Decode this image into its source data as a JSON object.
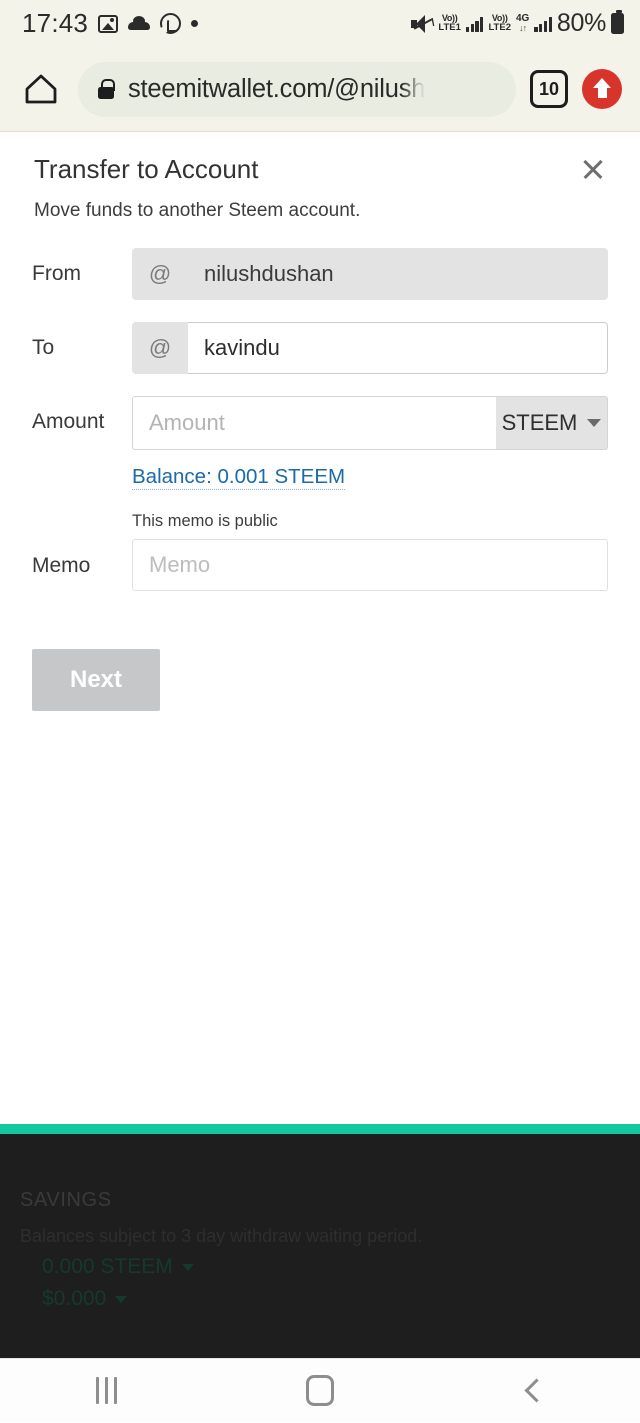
{
  "status_bar": {
    "time": "17:43",
    "battery_percent": "80%",
    "volte1_top": "Vo))",
    "volte1_bottom": "LTE1",
    "volte2_top": "Vo))",
    "volte2_bottom": "LTE2",
    "network": "4G",
    "network_arrows": "↓↑",
    "icons": [
      "image-icon",
      "cloud-icon",
      "whatsapp-icon",
      "dot-icon",
      "mute-icon",
      "signal-icon",
      "battery-icon"
    ]
  },
  "browser": {
    "url": "steemitwallet.com/@nilush",
    "tab_count": "10",
    "home_icon": "home-icon",
    "lock_icon": "lock-icon",
    "upload_icon": "upload-arrow-icon"
  },
  "modal": {
    "title": "Transfer to Account",
    "subtitle": "Move funds to another Steem account.",
    "close_label": "×"
  },
  "form": {
    "from": {
      "label": "From",
      "prefix": "@",
      "value": "nilushdushan",
      "readonly": true
    },
    "to": {
      "label": "To",
      "prefix": "@",
      "value": "kavindu",
      "placeholder": ""
    },
    "amount": {
      "label": "Amount",
      "placeholder": "Amount",
      "value": "",
      "unit": "STEEM",
      "balance_link": "Balance: 0.001 STEEM"
    },
    "memo": {
      "label": "Memo",
      "hint": "This memo is public",
      "placeholder": "Memo",
      "value": ""
    },
    "submit": {
      "label": "Next",
      "disabled": true
    }
  },
  "background_panel": {
    "savings_title": "SAVINGS",
    "savings_note": "Balances subject to 3 day withdraw waiting period.",
    "savings_steem": "0.000 STEEM",
    "savings_usd": "$0.000"
  },
  "nav_bar": {
    "recents": "recents-icon",
    "home": "home-icon",
    "back": "back-icon"
  },
  "colors": {
    "chrome_bg": "#f3f3ea",
    "url_pill": "#e9ece1",
    "upload_red": "#d9342b",
    "teal": "#14c8a0",
    "link_blue": "#1a6ba8",
    "disabled_btn": "#c5c7c9",
    "dark_panel": "#1e1e1e"
  }
}
